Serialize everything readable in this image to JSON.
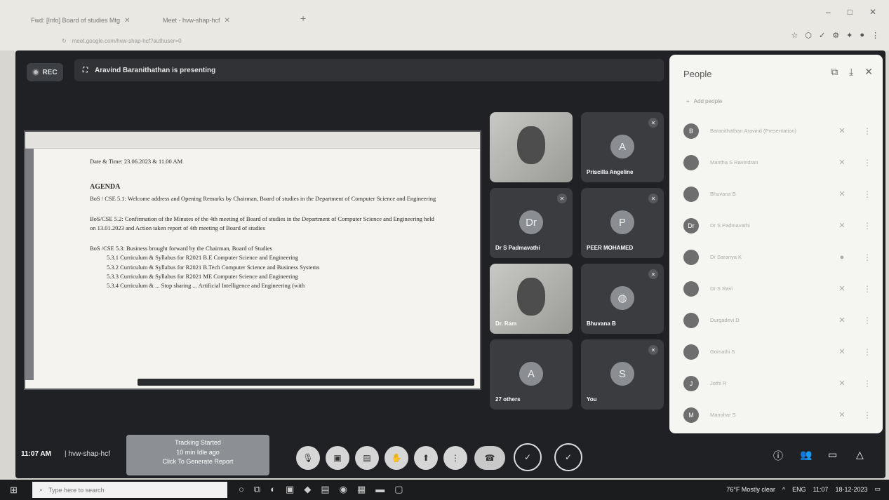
{
  "browser": {
    "tab1_title": "Fwd: [Info] Board of studies Mtg",
    "tab2_title": "Meet - hvw-shap-hcf",
    "url": "meet.google.com/hvw-shap-hcf?authuser=0",
    "minimize": "–",
    "maximize": "□",
    "close": "✕",
    "new_tab": "+"
  },
  "meet": {
    "rec_label": "REC",
    "presenting_text": "Aravind Baranithathan is presenting",
    "time": "11:07 AM",
    "meeting_code": "hvw-shap-hcf",
    "separator": "|"
  },
  "document": {
    "date_line": "Date & Time: 23.06.2023 & 11.00 AM",
    "agenda_heading": "AGENDA",
    "item1": "BoS / CSE 5.1: Welcome address and Opening Remarks by Chairman, Board of studies in the Department of Computer Science and Engineering",
    "item2": "BoS/CSE 5.2: Confirmation of the Minutes of the 4th meeting of Board of studies in the Department of Computer Science and Engineering held on 13.01.2023 and Action taken report of 4th meeting of Board of studies",
    "item3": "BoS /CSE 5.3: Business brought forward by the Chairman, Board of Studies",
    "sub1": "5.3.1 Curriculum & Syllabus for R2021 B.E Computer Science and Engineering",
    "sub2": "5.3.2 Curriculum & Syllabus for R2021 B.Tech Computer Science and Business Systems",
    "sub3": "5.3.3 Curriculum & Syllabus for R2021 ME Computer Science and Engineering",
    "sub4": "5.3.4 Curriculum & ... Stop sharing ... Artificial Intelligence and Engineering (with"
  },
  "tiles": [
    {
      "name": "",
      "initial": ""
    },
    {
      "name": "Priscilla Angeline",
      "initial": "A"
    },
    {
      "name": "Dr S Padmavathi",
      "initial": "Dr"
    },
    {
      "name": "PEER MOHAMED",
      "initial": "P"
    },
    {
      "name": "Dr. Ram",
      "initial": ""
    },
    {
      "name": "Bhuvana B",
      "initial": ""
    },
    {
      "name": "27 others",
      "initial": "A"
    },
    {
      "name": "You",
      "initial": "S"
    }
  ],
  "people_panel": {
    "title": "People",
    "add_people": "Add people",
    "participants": [
      {
        "initial": "B",
        "name": "Baranithathan Aravind (Presentation)"
      },
      {
        "initial": "",
        "name": "Mantha S Ravindran"
      },
      {
        "initial": "",
        "name": "Bhuvana B"
      },
      {
        "initial": "Dr",
        "name": "Dr S Padmavathi"
      },
      {
        "initial": "",
        "name": "Dr Saranya K"
      },
      {
        "initial": "",
        "name": "Dr S Ravi"
      },
      {
        "initial": "",
        "name": "Durgadevi D"
      },
      {
        "initial": "",
        "name": "Gomathi S"
      },
      {
        "initial": "J",
        "name": "Jothi R"
      },
      {
        "initial": "M",
        "name": "Manohar S"
      }
    ],
    "mic_icon": "🎙",
    "more_icon": "⋮",
    "close_icon": "✕"
  },
  "notification": {
    "line1": "Tracking Started",
    "line2": "10 min Idle ago",
    "line3": "Click To Generate Report"
  },
  "taskbar": {
    "search_placeholder": "Type here to search",
    "weather": "76°F Mostly clear",
    "lang": "ENG",
    "time": "11:07",
    "date": "18-12-2023"
  },
  "colors": {
    "meet_bg": "#1f2125",
    "tile_bg": "#3a3c40",
    "panel_bg": "#f5f5f2"
  }
}
